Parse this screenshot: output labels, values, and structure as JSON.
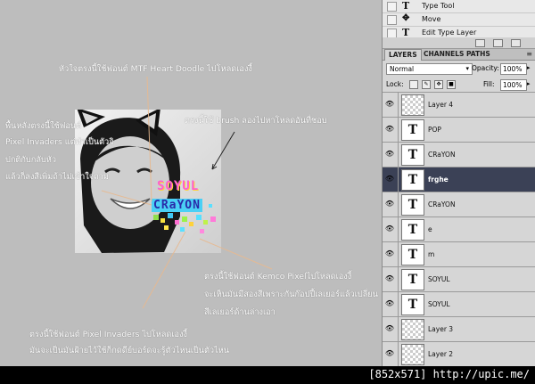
{
  "history": [
    {
      "label": "Type Tool",
      "icon": "type-tool-icon",
      "glyph": "T"
    },
    {
      "label": "Move",
      "icon": "move-tool-icon",
      "glyph": "✥"
    },
    {
      "label": "Edit Type Layer",
      "icon": "type-tool-icon",
      "glyph": "T"
    }
  ],
  "tabs": [
    {
      "label": "LAYERS",
      "active": true
    },
    {
      "label": "CHANNELS",
      "active": false
    },
    {
      "label": "PATHS",
      "active": false
    }
  ],
  "options": {
    "blend_mode": "Normal",
    "opacity_label": "Opacity:",
    "opacity_value": "100%",
    "lock_label": "Lock:",
    "fill_label": "Fill:",
    "fill_value": "100%"
  },
  "layers": [
    {
      "name": "Layer 4",
      "type": "raster",
      "selected": false
    },
    {
      "name": "POP",
      "type": "text",
      "selected": false
    },
    {
      "name": "CRaYON",
      "type": "text",
      "selected": false
    },
    {
      "name": "frghe",
      "type": "text",
      "selected": true
    },
    {
      "name": "CRaYON",
      "type": "text",
      "selected": false
    },
    {
      "name": "e",
      "type": "text",
      "selected": false
    },
    {
      "name": "m",
      "type": "text",
      "selected": false
    },
    {
      "name": "SOYUL",
      "type": "text",
      "selected": false
    },
    {
      "name": "SOYUL",
      "type": "text",
      "selected": false
    },
    {
      "name": "Layer 3",
      "type": "raster",
      "selected": false
    },
    {
      "name": "Layer 2",
      "type": "raster",
      "selected": false
    }
  ],
  "artwork": {
    "line1": "SOYUL",
    "line2": "CRaYON"
  },
  "annotations": {
    "heart_font": "หัวใจตรงนี้ใช้ฟอนต์ MTF Heart Doodle ไปโหลดเองงี้",
    "bg_font_l1": "พื้นหลังตรงนี้ใช้ฟอนต์",
    "bg_font_l2": "Pixel Invaders แต่ทำเป็นตัวจิ",
    "bg_font_l3": "ปกติกับกลับหัว",
    "bg_font_l4": "แล้วก็ลงสีเพิ่มถ้าไม่เข้าใจถาม",
    "brush": "ตรงนี้ใช้ brush ลองไปหาโหลดอันที่ชอบ",
    "kemco_l1": "ตรงนี้ใช้ฟอนต์ Kemco Pixelไปโหลดเองงี้",
    "kemco_l2": "จะเห็นมันมีสองสีเพราะกันก๊อปปี้เลเยอร์แล้วเปลี่ยน",
    "kemco_l3": "สีเลเยอร์ด้านล่างเอา",
    "invaders_l1": "ตรงนี้ใช้ฟอนต์ Pixel Invaders ไปโหลดเองงี้",
    "invaders_l2": "มันจะเป็นมันฝ้ายไว้ใช้ก็กดดีย์บอร์ดจะรู้ตัวไหนเป็นตัวไหน"
  },
  "footer": "[852x571] http://upic.me/",
  "colors": {
    "selected_layer": "#3b4156",
    "panel_bg": "#d6d6d6",
    "canvas_bg": "#bdbdbd"
  }
}
